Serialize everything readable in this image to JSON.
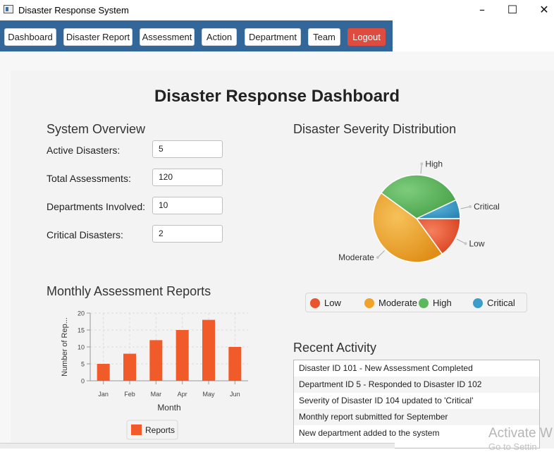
{
  "window": {
    "title": "Disaster Response System",
    "controls": [
      "–",
      "☐",
      "✕"
    ]
  },
  "nav": {
    "buttons": [
      "Dashboard",
      "Disaster Report",
      "Assessment",
      "Action",
      "Department",
      "Team"
    ],
    "logout": "Logout",
    "colors": {
      "bar": "#336699",
      "logout": "#e04b3f"
    }
  },
  "dashboard": {
    "title": "Disaster Response Dashboard"
  },
  "overview": {
    "title": "System Overview",
    "stats": [
      {
        "label": "Active Disasters:",
        "value": "5"
      },
      {
        "label": "Total Assessments:",
        "value": "120"
      },
      {
        "label": "Departments Involved:",
        "value": "10"
      },
      {
        "label": "Critical Disasters:",
        "value": "2"
      }
    ]
  },
  "severity": {
    "title": "Disaster Severity Distribution",
    "legend": [
      {
        "label": "Low",
        "color": "#e8552e"
      },
      {
        "label": "Moderate",
        "color": "#f0a22a"
      },
      {
        "label": "High",
        "color": "#5cb85c"
      },
      {
        "label": "Critical",
        "color": "#3a9ec9"
      }
    ]
  },
  "monthly": {
    "title": "Monthly Assessment Reports"
  },
  "activity": {
    "title": "Recent Activity",
    "items": [
      "Disaster ID 101 - New Assessment Completed",
      "Department ID 5 - Responded to Disaster ID 102",
      "Severity of Disaster ID 104 updated to 'Critical'",
      "Monthly report submitted for September",
      "New department added to the system"
    ]
  },
  "watermark": {
    "line1": "Activate W",
    "line2": "Go to Settin"
  },
  "chart_data": [
    {
      "type": "bar",
      "title": "Monthly Assessment Reports",
      "categories": [
        "Jan",
        "Feb",
        "Mar",
        "Apr",
        "May",
        "Jun"
      ],
      "series": [
        {
          "name": "Reports",
          "values": [
            5,
            8,
            12,
            15,
            18,
            10
          ]
        }
      ],
      "xlabel": "Month",
      "ylabel": "Number of Rep...",
      "ylim": [
        0,
        20
      ],
      "yticks": [
        0,
        5,
        10,
        15,
        20
      ],
      "grid": true,
      "legend": "bottom",
      "color": "#f15a29"
    },
    {
      "type": "pie",
      "title": "Disaster Severity Distribution",
      "labels": [
        "Low",
        "Moderate",
        "High",
        "Critical"
      ],
      "values": [
        15,
        45,
        33,
        7
      ],
      "colors": [
        "#e8552e",
        "#f0a22a",
        "#5cb85c",
        "#3a9ec9"
      ],
      "legend": "bottom"
    }
  ]
}
